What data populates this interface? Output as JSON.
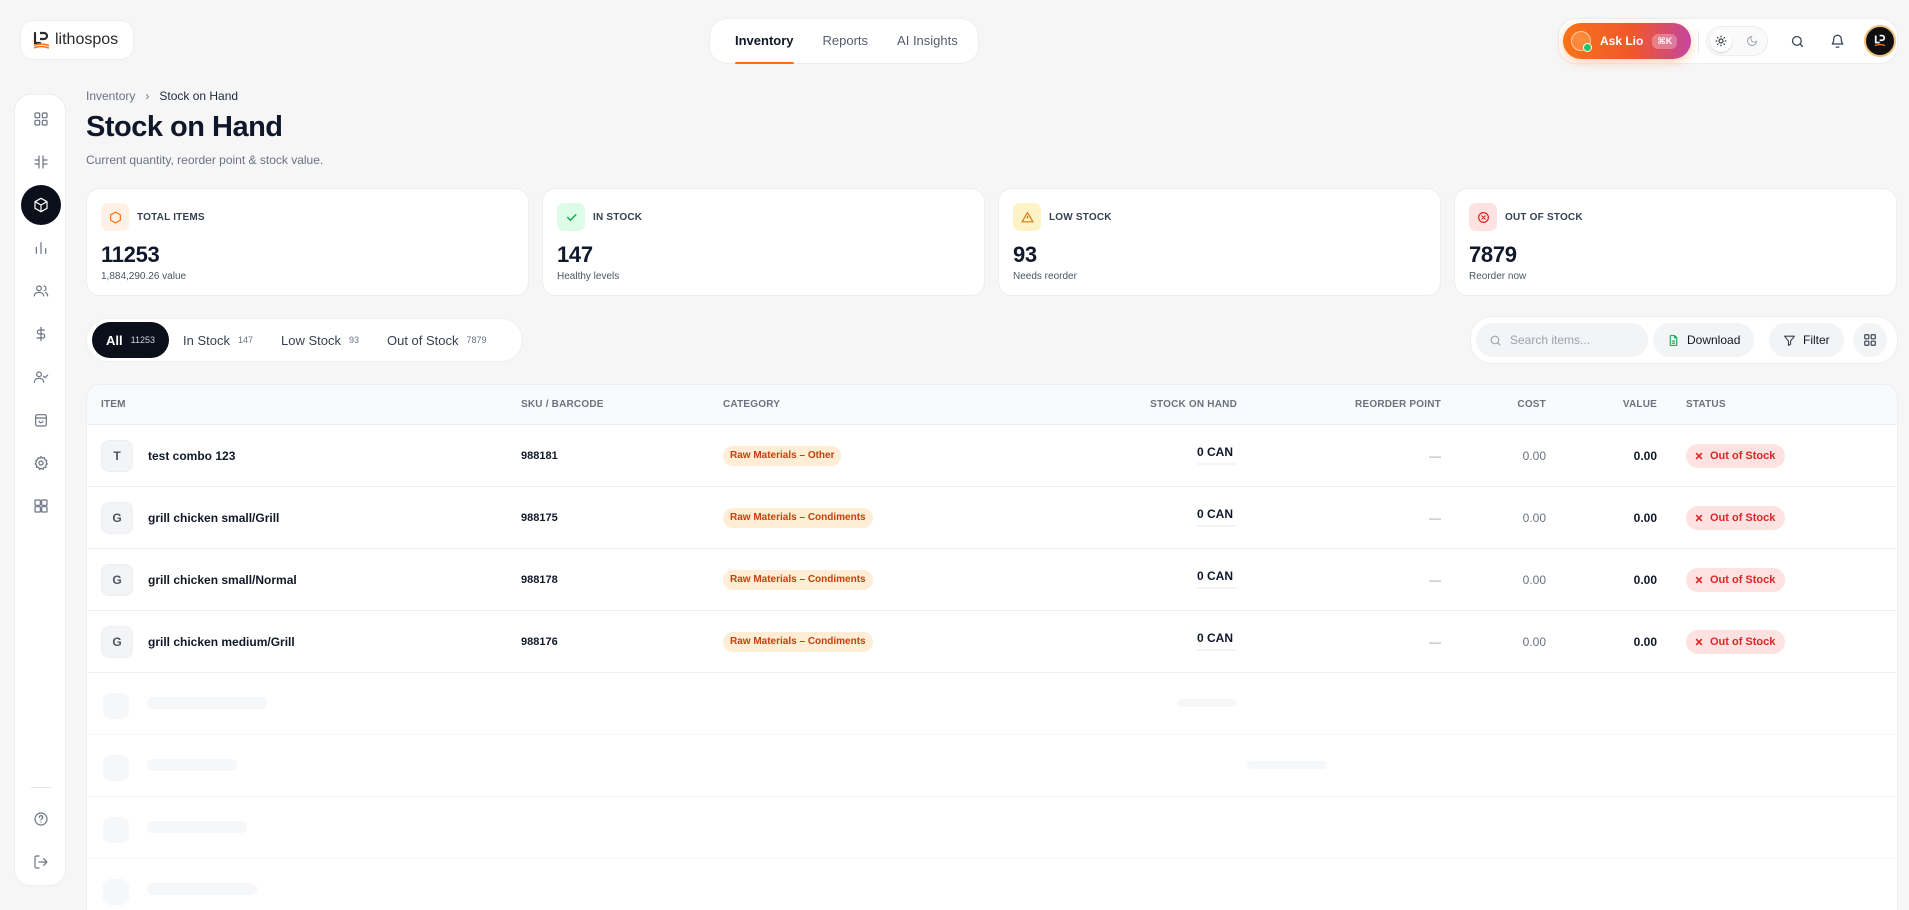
{
  "brand": {
    "name": "lithospos"
  },
  "topnav": {
    "tabs": [
      {
        "label": "Inventory",
        "active": true
      },
      {
        "label": "Reports"
      },
      {
        "label": "AI Insights"
      }
    ]
  },
  "topright": {
    "ask_label": "Ask Lio",
    "ask_shortcut": "⌘K"
  },
  "sidebar": {
    "items": [
      "dashboard-icon",
      "grid-icon",
      "box-icon",
      "chart-icon",
      "users-icon",
      "dollar-icon",
      "user-check-icon",
      "bag-icon",
      "gear-icon",
      "apps-icon"
    ],
    "active": "box-icon",
    "footer": [
      "help-icon",
      "logout-icon"
    ]
  },
  "breadcrumb": {
    "parent": "Inventory",
    "sep": "›",
    "current": "Stock on Hand"
  },
  "page": {
    "title": "Stock on Hand",
    "subtitle": "Current quantity, reorder point & stock value."
  },
  "stats": [
    {
      "label": "TOTAL ITEMS",
      "value": "11253",
      "note": "1,884,290.26 value",
      "color": "#f97316"
    },
    {
      "label": "IN STOCK",
      "value": "147",
      "note": "Healthy levels",
      "color": "#16a34a"
    },
    {
      "label": "LOW STOCK",
      "value": "93",
      "note": "Needs reorder",
      "color": "#d97706"
    },
    {
      "label": "OUT OF STOCK",
      "value": "7879",
      "note": "Reorder now",
      "color": "#dc2626"
    }
  ],
  "filters": [
    {
      "label": "All",
      "count": "11253",
      "active": true
    },
    {
      "label": "In Stock",
      "count": "147"
    },
    {
      "label": "Low Stock",
      "count": "93"
    },
    {
      "label": "Out of Stock",
      "count": "7879"
    }
  ],
  "toolbar": {
    "search_placeholder": "Search items...",
    "download_label": "Download",
    "filter_label": "Filter"
  },
  "table": {
    "headers": {
      "item": "ITEM",
      "sku": "SKU / BARCODE",
      "category": "CATEGORY",
      "stock": "STOCK ON HAND",
      "reorder": "REORDER POINT",
      "cost": "COST",
      "value": "VALUE",
      "status": "STATUS"
    },
    "rows": [
      {
        "initial": "T",
        "name": "test combo 123",
        "sku": "988181",
        "category": "Raw Materials – Other",
        "stock": "0 CAN",
        "reorder": "—",
        "cost": "0.00",
        "value": "0.00",
        "status": "Out of Stock"
      },
      {
        "initial": "G",
        "name": "grill chicken small/Grill",
        "sku": "988175",
        "category": "Raw Materials – Condiments",
        "stock": "0 CAN",
        "reorder": "—",
        "cost": "0.00",
        "value": "0.00",
        "status": "Out of Stock"
      },
      {
        "initial": "G",
        "name": "grill chicken small/Normal",
        "sku": "988178",
        "category": "Raw Materials – Condiments",
        "stock": "0 CAN",
        "reorder": "—",
        "cost": "0.00",
        "value": "0.00",
        "status": "Out of Stock"
      },
      {
        "initial": "G",
        "name": "grill chicken medium/Grill",
        "sku": "988176",
        "category": "Raw Materials – Condiments",
        "stock": "0 CAN",
        "reorder": "—",
        "cost": "0.00",
        "value": "0.00",
        "status": "Out of Stock"
      }
    ]
  }
}
